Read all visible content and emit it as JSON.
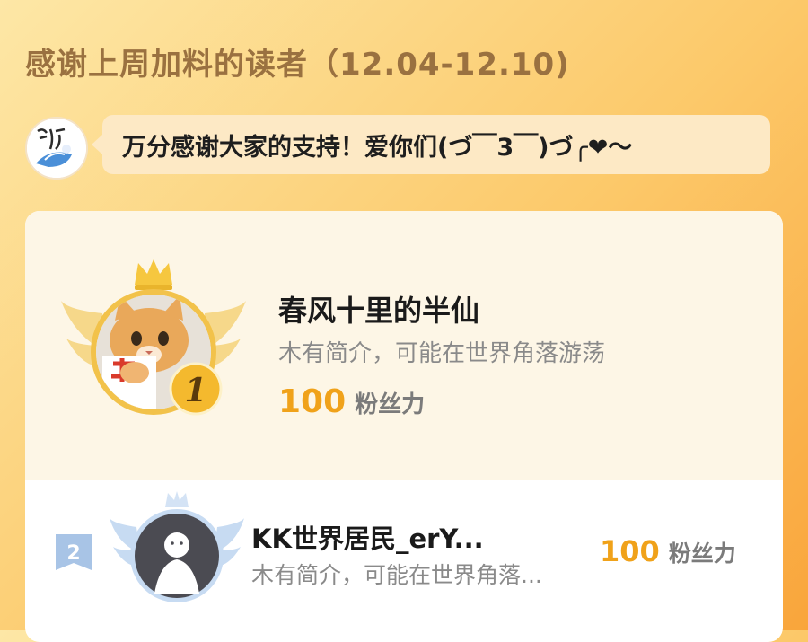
{
  "header": {
    "title": "感谢上周加料的读者（12.04-12.10)"
  },
  "author": {
    "avatar_icon": "author-avatar-logo",
    "message": "万分感谢大家的支持！爱你们(づ￣3￣)づ╭❤～"
  },
  "leaderboard": {
    "entries": [
      {
        "rank": "1",
        "name": "春风十里的半仙",
        "intro": "木有简介，可能在世界角落游荡",
        "points": "100",
        "points_unit": "粉丝力",
        "avatar_icon": "cat-avatar",
        "badge_icon": "crown-icon"
      },
      {
        "rank": "2",
        "name": "KK世界居民_erY...",
        "intro": "木有简介，可能在世界角落...",
        "points": "100",
        "points_unit": "粉丝力",
        "avatar_icon": "default-user-avatar",
        "badge_icon": "rank-flag-icon"
      }
    ]
  },
  "colors": {
    "background_start": "#fde7a6",
    "background_end": "#f9a53b",
    "title": "#9a7140",
    "bubble": "#fde9c5",
    "points": "#f0a21a",
    "gold_badge": "#f4b92e",
    "rank2_badge": "#a8c4e6"
  }
}
